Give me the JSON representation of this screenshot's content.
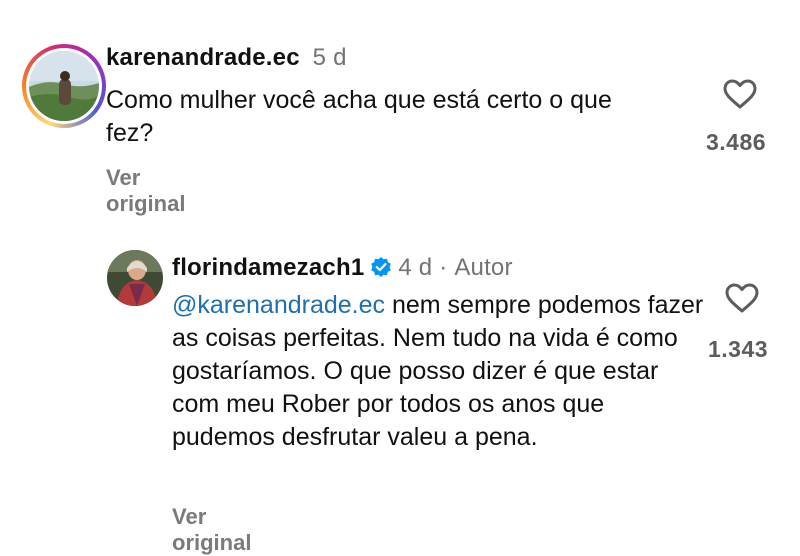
{
  "comments": [
    {
      "username": "karenandrade.ec",
      "time": "5 d",
      "text": "Como mulher você acha que está certo o que fez?",
      "see_original": "Ver original",
      "likes": "3.486",
      "avatar_icon": "profile-photo-landscape"
    },
    {
      "username": "florindamezach1",
      "time": "4 d",
      "separator": "·",
      "author_label": "Autor",
      "mention": "@karenandrade.ec",
      "text": " nem sempre podemos fazer as coisas perfeitas. Nem tudo na vida é como gostaríamos. O que posso dizer é que estar com meu Rober por todos os anos que pudemos desfrutar valeu a pena.",
      "see_original": "Ver original",
      "likes": "1.343",
      "avatar_icon": "profile-photo-person",
      "verified_icon": "verified-badge-icon"
    }
  ],
  "colors": {
    "mention": "#1e6fb0",
    "meta_gray": "#737373",
    "verified_blue": "#0095f6"
  }
}
